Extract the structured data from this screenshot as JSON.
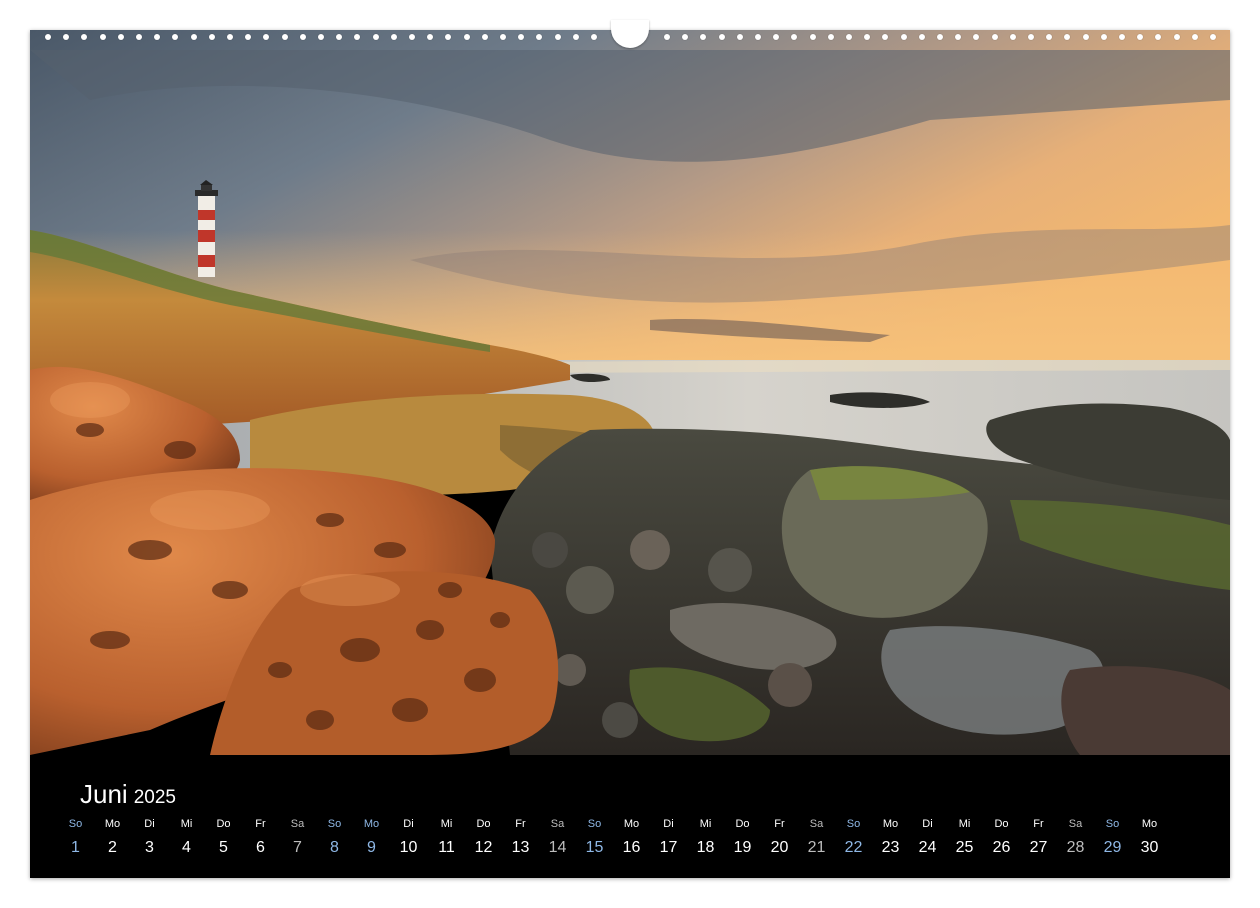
{
  "calendar": {
    "month": "Juni",
    "year": "2025",
    "days": [
      {
        "wd": "So",
        "d": "1",
        "kind": "sun"
      },
      {
        "wd": "Mo",
        "d": "2",
        "kind": ""
      },
      {
        "wd": "Di",
        "d": "3",
        "kind": ""
      },
      {
        "wd": "Mi",
        "d": "4",
        "kind": ""
      },
      {
        "wd": "Do",
        "d": "5",
        "kind": ""
      },
      {
        "wd": "Fr",
        "d": "6",
        "kind": ""
      },
      {
        "wd": "Sa",
        "d": "7",
        "kind": "sat"
      },
      {
        "wd": "So",
        "d": "8",
        "kind": "sun"
      },
      {
        "wd": "Mo",
        "d": "9",
        "kind": "hol"
      },
      {
        "wd": "Di",
        "d": "10",
        "kind": ""
      },
      {
        "wd": "Mi",
        "d": "11",
        "kind": ""
      },
      {
        "wd": "Do",
        "d": "12",
        "kind": ""
      },
      {
        "wd": "Fr",
        "d": "13",
        "kind": ""
      },
      {
        "wd": "Sa",
        "d": "14",
        "kind": "sat"
      },
      {
        "wd": "So",
        "d": "15",
        "kind": "sun"
      },
      {
        "wd": "Mo",
        "d": "16",
        "kind": ""
      },
      {
        "wd": "Di",
        "d": "17",
        "kind": ""
      },
      {
        "wd": "Mi",
        "d": "18",
        "kind": ""
      },
      {
        "wd": "Do",
        "d": "19",
        "kind": ""
      },
      {
        "wd": "Fr",
        "d": "20",
        "kind": ""
      },
      {
        "wd": "Sa",
        "d": "21",
        "kind": "sat"
      },
      {
        "wd": "So",
        "d": "22",
        "kind": "sun"
      },
      {
        "wd": "Mo",
        "d": "23",
        "kind": ""
      },
      {
        "wd": "Di",
        "d": "24",
        "kind": ""
      },
      {
        "wd": "Mi",
        "d": "25",
        "kind": ""
      },
      {
        "wd": "Do",
        "d": "26",
        "kind": ""
      },
      {
        "wd": "Fr",
        "d": "27",
        "kind": ""
      },
      {
        "wd": "Sa",
        "d": "28",
        "kind": "sat"
      },
      {
        "wd": "So",
        "d": "29",
        "kind": "sun"
      },
      {
        "wd": "Mo",
        "d": "30",
        "kind": ""
      }
    ]
  },
  "colors": {
    "weekday": "#ffffff",
    "saturday": "#bdbdbd",
    "sunday_holiday": "#8fb8e6",
    "background": "#000000"
  }
}
